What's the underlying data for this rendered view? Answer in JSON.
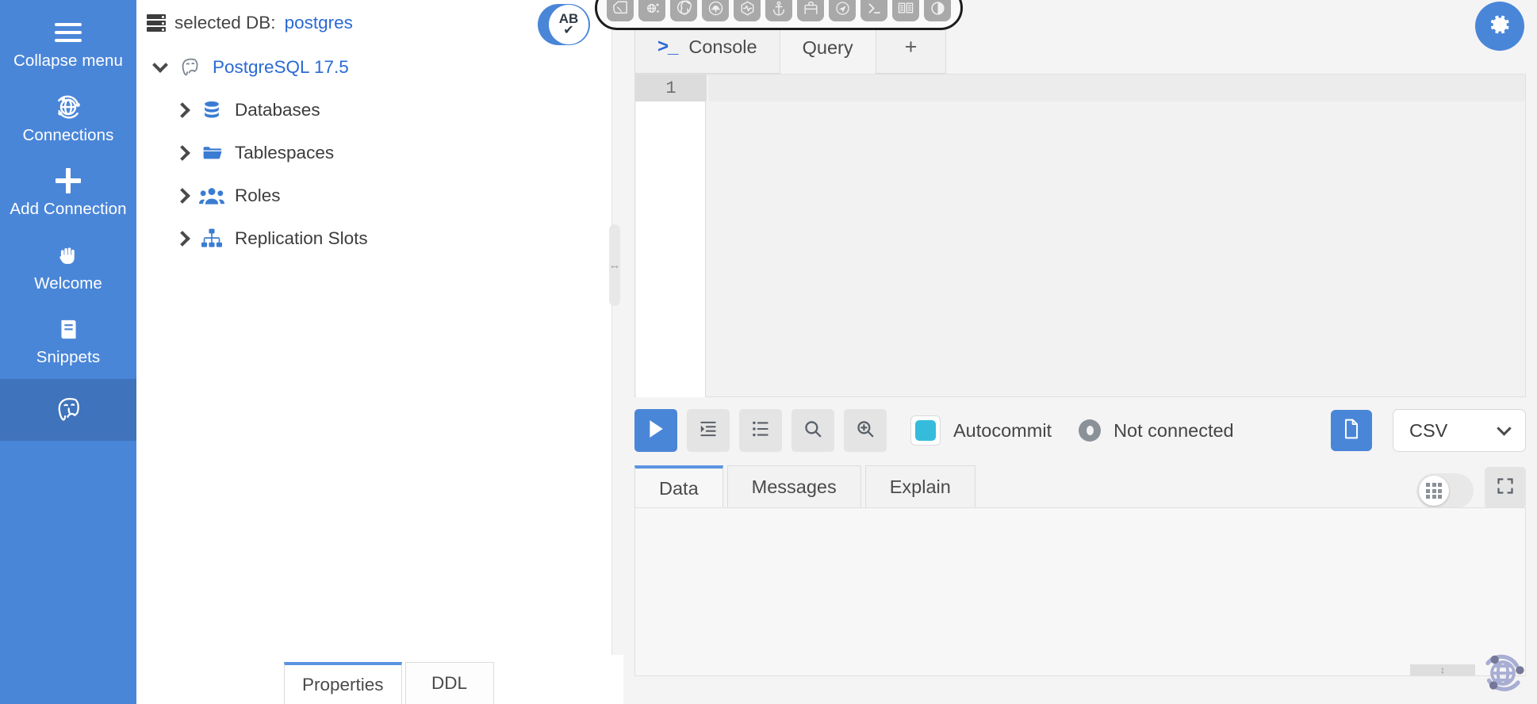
{
  "rail": {
    "items": [
      {
        "label": "Collapse menu",
        "icon": "hamburger-icon",
        "active": false
      },
      {
        "label": "Connections",
        "icon": "globe-network-icon",
        "active": false
      },
      {
        "label": "Add Connection",
        "icon": "plus-icon",
        "active": false
      },
      {
        "label": "Welcome",
        "icon": "hand-wave-icon",
        "active": false
      },
      {
        "label": "Snippets",
        "icon": "book-icon",
        "active": false
      },
      {
        "label": "",
        "icon": "postgresql-elephant-icon",
        "active": true
      }
    ]
  },
  "nav": {
    "selected_db_prefix": "selected DB:",
    "selected_db_name": "postgres",
    "tree": [
      {
        "label": "PostgreSQL 17.5",
        "icon": "postgresql-elephant-icon",
        "expanded": true,
        "level": 1,
        "link": true
      },
      {
        "label": "Databases",
        "icon": "database-icon",
        "expanded": false,
        "level": 2,
        "link": false
      },
      {
        "label": "Tablespaces",
        "icon": "folder-icon",
        "expanded": false,
        "level": 2,
        "link": false
      },
      {
        "label": "Roles",
        "icon": "users-icon",
        "expanded": false,
        "level": 2,
        "link": false
      },
      {
        "label": "Replication Slots",
        "icon": "sitemap-icon",
        "expanded": false,
        "level": 2,
        "link": false
      }
    ],
    "bottom_tabs": [
      {
        "label": "Properties",
        "active": true
      },
      {
        "label": "DDL",
        "active": false
      }
    ],
    "resize_icon": "vertical-resize-icon"
  },
  "editor": {
    "tabs": [
      {
        "label": "Console",
        "icon": "terminal-icon",
        "active": false
      },
      {
        "label": "Query",
        "icon": "",
        "active": true
      },
      {
        "label": "+",
        "icon": "",
        "active": false,
        "is_new": true
      }
    ],
    "line_number": "1",
    "sql_text": ""
  },
  "toolbar": {
    "buttons": [
      {
        "name": "execute-sql-button",
        "icon": "play-icon",
        "primary": true
      },
      {
        "name": "execute-script-button",
        "icon": "script-indent-icon",
        "primary": false
      },
      {
        "name": "execute-statements-list-button",
        "icon": "list-icon",
        "primary": false
      },
      {
        "name": "search-button",
        "icon": "magnifier-icon",
        "primary": false
      },
      {
        "name": "explain-plan-button",
        "icon": "magnifier-plus-icon",
        "primary": false
      }
    ],
    "autocommit_label": "Autocommit",
    "autocommit_on": true,
    "autocommit_color": "#35bcdc",
    "connection_status": "Not connected",
    "export_icon": "file-export-icon",
    "format_selected": "CSV",
    "format_options": [
      "CSV"
    ]
  },
  "results": {
    "tabs": [
      {
        "label": "Data",
        "active": true
      },
      {
        "label": "Messages",
        "active": false
      },
      {
        "label": "Explain",
        "active": false
      }
    ],
    "grid_toggle_icon": "grid-view-icon",
    "maximize_icon": "fullscreen-icon"
  },
  "overlays": {
    "ab_badge": {
      "text": "AB",
      "check": "✔",
      "name": "ab-check-badge"
    },
    "gear_fab": {
      "icon": "gear-icon"
    },
    "watermark": {
      "icon": "globe-network-watermark-icon"
    },
    "dock_icons": [
      "liver-app-icon",
      "globe-network-icon",
      "spiral-gear-icon",
      "anvil-icon",
      "pulse-hexagon-icon",
      "anchor-icon",
      "sofa-icon",
      "airplane-circle-icon",
      "terminal-prompt-icon",
      "book-open-icon",
      "contrast-circle-icon"
    ]
  },
  "colors": {
    "brand_blue": "#4a86d8",
    "accent_tab": "#5a94e0",
    "link": "#2a6ad4",
    "rail_active": "#3f73bc"
  }
}
